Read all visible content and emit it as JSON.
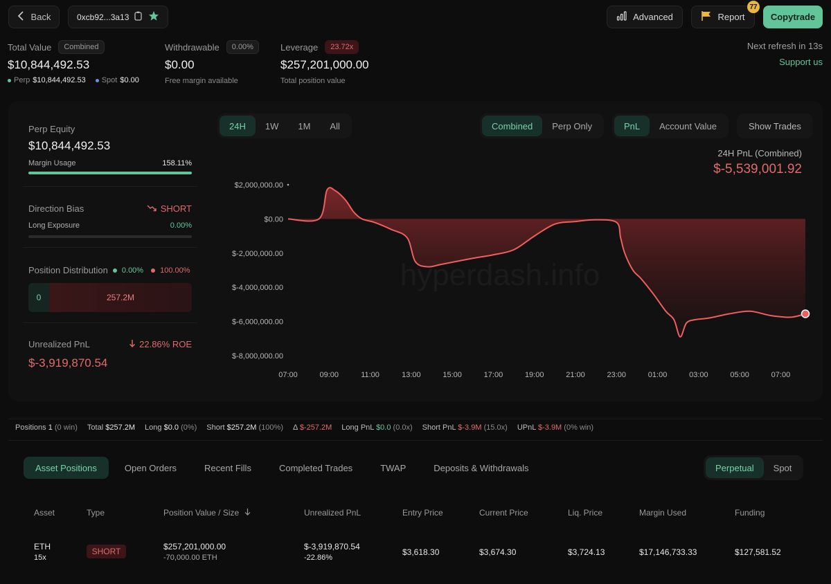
{
  "topbar": {
    "back_label": "Back",
    "address": "0xcb92...3a13",
    "advanced_label": "Advanced",
    "report_label": "Report",
    "report_badge": "77",
    "copytrade_label": "Copytrade"
  },
  "stats": {
    "total_value_label": "Total Value",
    "total_value_pill": "Combined",
    "total_value": "$10,844,492.53",
    "perp_label": "Perp",
    "perp_value": "$10,844,492.53",
    "spot_label": "Spot",
    "spot_value": "$0.00",
    "withdrawable_label": "Withdrawable",
    "withdrawable_pill": "0.00%",
    "withdrawable_value": "$0.00",
    "withdrawable_sub": "Free margin available",
    "leverage_label": "Leverage",
    "leverage_pill": "23.72x",
    "leverage_value": "$257,201,000.00",
    "leverage_sub": "Total position value",
    "refresh_text": "Next refresh in 13s",
    "support_label": "Support us"
  },
  "left": {
    "perp_equity_label": "Perp Equity",
    "perp_equity_value": "$10,844,492.53",
    "margin_usage_label": "Margin Usage",
    "margin_usage_value": "158.11%",
    "margin_usage_fraction": 1.0,
    "direction_bias_label": "Direction Bias",
    "direction_bias_value": "SHORT",
    "long_exposure_label": "Long Exposure",
    "long_exposure_value": "0.00%",
    "position_dist_label": "Position Distribution",
    "dist_long_pct": "0.00%",
    "dist_short_pct": "100.00%",
    "dist_long_value": "0",
    "dist_short_value": "257.2M",
    "unrealized_label": "Unrealized PnL",
    "unrealized_roe": "22.86% ROE",
    "unrealized_value": "$-3,919,870.54"
  },
  "chart_controls": {
    "timeframes": [
      "24H",
      "1W",
      "1M",
      "All"
    ],
    "active_timeframe": "24H",
    "modes": [
      "Combined",
      "Perp Only"
    ],
    "active_mode": "Combined",
    "metrics": [
      "PnL",
      "Account Value"
    ],
    "active_metric": "PnL",
    "show_trades_label": "Show Trades",
    "pnl_title": "24H PnL (Combined)",
    "pnl_value": "$-5,539,001.92",
    "watermark": "hyperdash.info"
  },
  "chart_data": {
    "type": "area",
    "title": "",
    "xlabel": "",
    "ylabel": "",
    "x_ticks": [
      "07:00",
      "09:00",
      "11:00",
      "13:00",
      "15:00",
      "17:00",
      "19:00",
      "21:00",
      "23:00",
      "01:00",
      "03:00",
      "05:00",
      "07:00"
    ],
    "y_ticks": [
      "$2,000,000.00",
      "$0.00",
      "$-2,000,000.00",
      "$-4,000,000.00",
      "$-6,000,000.00",
      "$-8,000,000.00"
    ],
    "ylim": [
      -8000000,
      2000000
    ],
    "xlim": [
      0,
      25.2
    ],
    "x": [
      0,
      1.5,
      1.9,
      2.3,
      2.8,
      3.2,
      3.6,
      4.2,
      5,
      5.8,
      6.2,
      6.8,
      7.5,
      9,
      10,
      11,
      12,
      13,
      14,
      15,
      16,
      16.2,
      16.4,
      16.8,
      17.2,
      17.8,
      18.4,
      18.8,
      19.1,
      19.4,
      19.8,
      20.5,
      21.5,
      22.5,
      23.5,
      24.5,
      25.2
    ],
    "y": [
      0,
      0,
      1700000,
      1650000,
      1100000,
      400000,
      0,
      -200000,
      -600000,
      -1100000,
      -2500000,
      -2800000,
      -2650000,
      -2300000,
      -2100000,
      -1800000,
      -1000000,
      -300000,
      -150000,
      -50000,
      -200000,
      -1100000,
      -2000000,
      -3000000,
      -3500000,
      -4400000,
      -5400000,
      -5900000,
      -6900000,
      -6100000,
      -5900000,
      -5800000,
      -5550000,
      -5400000,
      -5650000,
      -5750000,
      -5550000
    ],
    "series_color": "#ef5f5f"
  },
  "summary": {
    "positions_label": "Positions",
    "positions_count": "1",
    "positions_win": "(0 win)",
    "total_label": "Total",
    "total_value": "$257.2M",
    "long_label": "Long",
    "long_value": "$0.0",
    "long_pct": "(0%)",
    "short_label": "Short",
    "short_value": "$257.2M",
    "short_pct": "(100%)",
    "delta_label": "Δ",
    "delta_value": "$-257.2M",
    "long_pnl_label": "Long PnL",
    "long_pnl_value": "$0.0",
    "long_pnl_x": "(0.0x)",
    "short_pnl_label": "Short PnL",
    "short_pnl_value": "$-3.9M",
    "short_pnl_x": "(15.0x)",
    "upnl_label": "UPnL",
    "upnl_value": "$-3.9M",
    "upnl_win": "(0% win)"
  },
  "tabs": {
    "items": [
      "Asset Positions",
      "Open Orders",
      "Recent Fills",
      "Completed Trades",
      "TWAP",
      "Deposits & Withdrawals"
    ],
    "active": "Asset Positions",
    "market_items": [
      "Perpetual",
      "Spot"
    ],
    "market_active": "Perpetual"
  },
  "table": {
    "headers": [
      "Asset",
      "Type",
      "Position Value / Size",
      "Unrealized PnL",
      "Entry Price",
      "Current Price",
      "Liq. Price",
      "Margin Used",
      "Funding"
    ],
    "row": {
      "asset": "ETH",
      "leverage": "15x",
      "type": "SHORT",
      "position_value": "$257,201,000.00",
      "position_size": "-70,000.00 ETH",
      "unrealized_pnl": "$-3,919,870.54",
      "unrealized_pct": "-22.86%",
      "entry_price": "$3,618.30",
      "current_price": "$3,674.30",
      "liq_price": "$3,724.13",
      "margin_used": "$17,146,733.33",
      "funding": "$127,581.52"
    }
  }
}
